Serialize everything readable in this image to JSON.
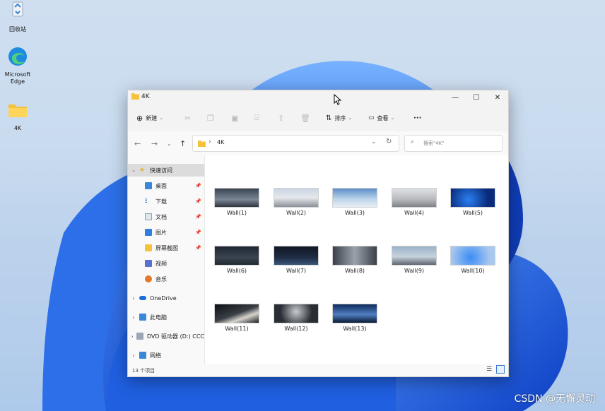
{
  "desktop": {
    "icons": [
      {
        "label": "回收站"
      },
      {
        "label": "Microsoft Edge"
      },
      {
        "label": "4K"
      }
    ],
    "watermark": "CSDN @无懈灵动"
  },
  "window": {
    "title": "4K",
    "controls": {
      "minimize": "—",
      "maximize": "☐",
      "close": "✕"
    },
    "toolbar": {
      "new_label": "新建",
      "sort_label": "排序",
      "view_label": "查看",
      "more_label": "···"
    },
    "address": {
      "path": "4K",
      "separator": "›"
    },
    "search": {
      "placeholder": "搜索\"4K\""
    },
    "sidebar": {
      "items": [
        {
          "label": "快速访问",
          "icon": "star-icon"
        },
        {
          "label": "桌面",
          "icon": "desktop-icon"
        },
        {
          "label": "下载",
          "icon": "download-icon"
        },
        {
          "label": "文档",
          "icon": "document-icon"
        },
        {
          "label": "图片",
          "icon": "pictures-icon"
        },
        {
          "label": "屏幕截图",
          "icon": "folder-icon"
        },
        {
          "label": "视频",
          "icon": "video-icon"
        },
        {
          "label": "音乐",
          "icon": "music-icon"
        },
        {
          "label": "OneDrive",
          "icon": "cloud-icon"
        },
        {
          "label": "此电脑",
          "icon": "pc-icon"
        },
        {
          "label": "DVD 驱动器 (D:) CCC",
          "icon": "dvd-icon"
        },
        {
          "label": "网络",
          "icon": "network-icon"
        }
      ]
    },
    "files": [
      {
        "name": "Wall(1)"
      },
      {
        "name": "Wall(2)"
      },
      {
        "name": "Wall(3)"
      },
      {
        "name": "Wall(4)"
      },
      {
        "name": "Wall(5)"
      },
      {
        "name": "Wall(6)"
      },
      {
        "name": "Wall(7)"
      },
      {
        "name": "Wall(8)"
      },
      {
        "name": "Wall(9)"
      },
      {
        "name": "Wall(10)"
      },
      {
        "name": "Wall(11)"
      },
      {
        "name": "Wall(12)"
      },
      {
        "name": "Wall(13)"
      }
    ],
    "status": "13 个项目"
  }
}
